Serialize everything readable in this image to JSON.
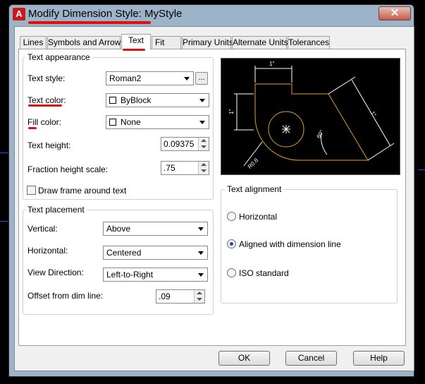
{
  "window": {
    "title": "Modify Dimension Style: MyStyle",
    "close_glyph": "✕",
    "app_icon_letter": "A"
  },
  "tabs": [
    {
      "label": "Lines"
    },
    {
      "label": "Symbols and Arrows"
    },
    {
      "label": "Text",
      "active": true
    },
    {
      "label": "Fit"
    },
    {
      "label": "Primary Units"
    },
    {
      "label": "Alternate Units"
    },
    {
      "label": "Tolerances"
    }
  ],
  "text_appearance": {
    "title": "Text appearance",
    "text_style_label": "Text style:",
    "text_style_value": "Roman2",
    "browse_label": "...",
    "text_color_label": "Text color:",
    "text_color_value": "ByBlock",
    "fill_color_label": "Fill color:",
    "fill_color_value": "None",
    "text_height_label": "Text height:",
    "text_height_value": "0.09375",
    "fraction_height_label": "Fraction height scale:",
    "fraction_height_value": ".75",
    "draw_frame_label": "Draw frame around text",
    "draw_frame_checked": false
  },
  "text_placement": {
    "title": "Text placement",
    "vertical_label": "Vertical:",
    "vertical_value": "Above",
    "horizontal_label": "Horizontal:",
    "horizontal_value": "Centered",
    "view_direction_label": "View Direction:",
    "view_direction_value": "Left-to-Right",
    "offset_label": "Offset from dim line:",
    "offset_value": ".09"
  },
  "preview": {
    "dim_top": "1\"",
    "dim_left": "1\"",
    "dim_slope": "1\"",
    "dim_angle": "60°",
    "dim_radius": "R0.8"
  },
  "text_alignment": {
    "title": "Text alignment",
    "options": [
      {
        "label": "Horizontal",
        "selected": false
      },
      {
        "label": "Aligned with dimension line",
        "selected": true
      },
      {
        "label": "ISO standard",
        "selected": false
      }
    ]
  },
  "buttons": {
    "ok": "OK",
    "cancel": "Cancel",
    "help": "Help"
  },
  "colors": {
    "annotation_red": "#e01010",
    "preview_outline": "#e0a030",
    "preview_dim": "#ffffff"
  }
}
